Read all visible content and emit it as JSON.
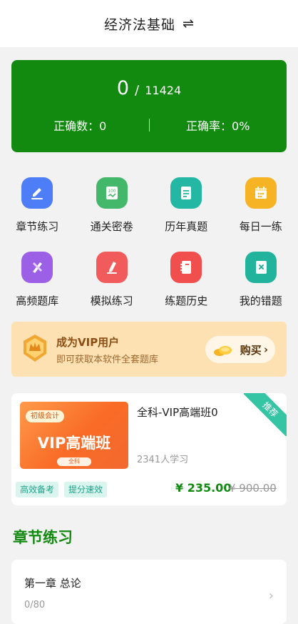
{
  "header": {
    "title": "经济法基础",
    "switch_icon": "⇌"
  },
  "stats": {
    "count": "0",
    "separator": "/",
    "total": "11424",
    "correct_count": "正确数：0",
    "correct_rate": "正确率：0%"
  },
  "grid": [
    {
      "label": "章节练习",
      "icon": "pen-edit-icon",
      "color": "#4d7ef7"
    },
    {
      "label": "通关密卷",
      "icon": "score-paper-icon",
      "color": "#43b86a"
    },
    {
      "label": "历年真题",
      "icon": "document-icon",
      "color": "#24b8a4"
    },
    {
      "label": "每日一练",
      "icon": "calendar-icon",
      "color": "#f6b323"
    },
    {
      "label": "高频题库",
      "icon": "pencil-ruler-icon",
      "color": "#9b60e6"
    },
    {
      "label": "模拟练习",
      "icon": "pen-paper-icon",
      "color": "#f25b5b"
    },
    {
      "label": "练题历史",
      "icon": "notebook-icon",
      "color": "#f14e4e"
    },
    {
      "label": "我的错题",
      "icon": "wrong-book-icon",
      "color": "#21b39b"
    }
  ],
  "vip": {
    "title": "成为VIP用户",
    "subtitle": "即可获取本软件全套题库",
    "buy_label": "购买",
    "buy_arrow": "›",
    "badge_icon": "vip-crown-badge-icon",
    "coin_icon": "gold-coins-icon"
  },
  "course": {
    "thumb_tag": "初级会计",
    "thumb_title": "VIP高端班",
    "thumb_button": "全科",
    "name": "全科-VIP高端班0",
    "learners": "2341人学习",
    "corner_label": "推荐",
    "tags": [
      "高效备考",
      "提分速效"
    ],
    "price_now": "¥ 235.00",
    "price_old": "¥ 900.00"
  },
  "chapters": {
    "section_title": "章节练习",
    "first": {
      "title": "第一章 总论",
      "progress": "0/80",
      "arrow": "›"
    }
  },
  "colors": {
    "brand": "#118a0f",
    "vip_bg": "#fde1b3",
    "accent_tag": "#35c4a4"
  }
}
